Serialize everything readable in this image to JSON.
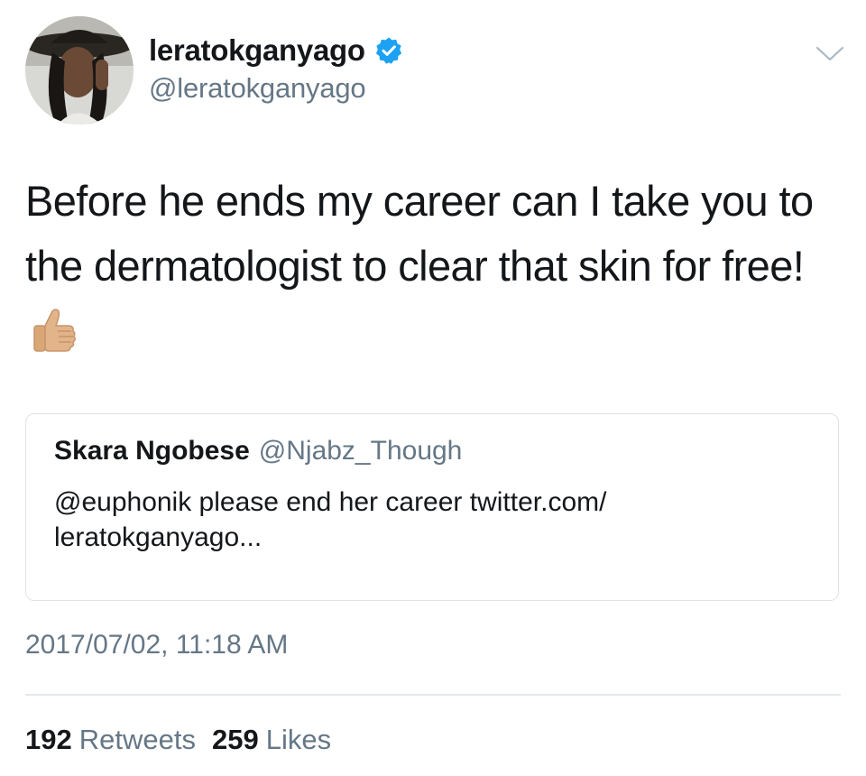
{
  "tweet": {
    "author": {
      "display_name": "leratokganyago",
      "handle": "@leratokganyago",
      "verified": true
    },
    "text": "Before he ends my career can I take you to the dermatologist to clear that skin for free!",
    "emoji": "thumbs-up-icon",
    "timestamp": "2017/07/02, 11:18 AM",
    "stats": {
      "retweets_count": "192",
      "retweets_label": "Retweets",
      "likes_count": "259",
      "likes_label": "Likes"
    }
  },
  "quoted_tweet": {
    "display_name": "Skara Ngobese",
    "handle": "@Njabz_Though",
    "text_line1": "@euphonik please end her career twitter.com/",
    "text_line2": "leratokganyago..."
  },
  "colors": {
    "text": "#14171a",
    "secondary": "#657786",
    "verified": "#1da1f2",
    "border": "#dfe3e7"
  }
}
